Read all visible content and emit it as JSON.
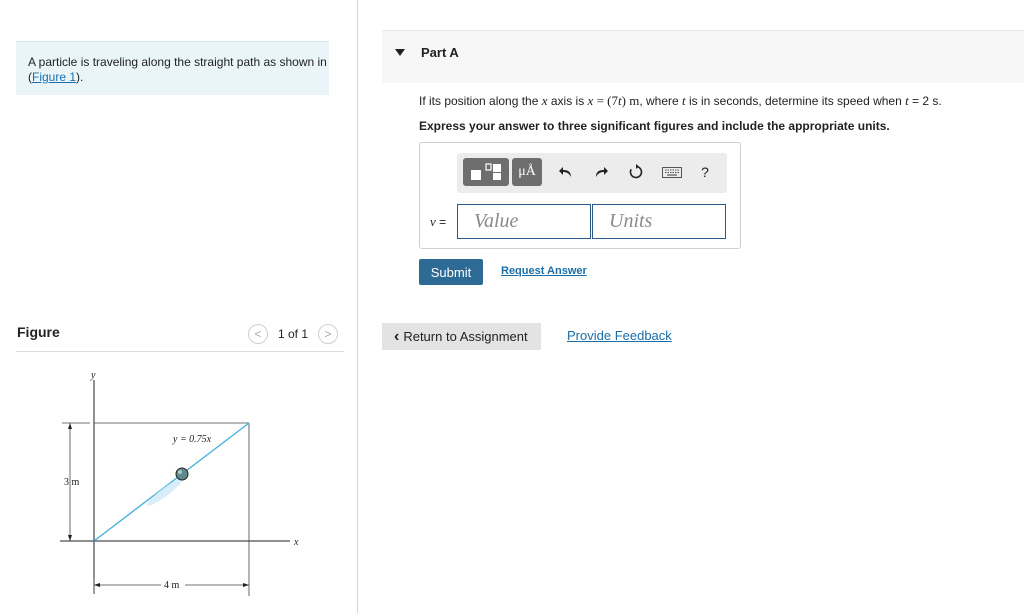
{
  "left_panel": {
    "intro_text": "A particle is traveling along the straight path as shown in",
    "intro_link_open": "(",
    "intro_link": "Figure 1",
    "intro_link_close": ").",
    "figure_heading": "Figure",
    "pager": {
      "prev": "<",
      "text": "1 of 1",
      "next": ">"
    }
  },
  "figure": {
    "axis_y": "y",
    "axis_x": "x",
    "line_equation": "y = 0.75x",
    "height_label": "3 m",
    "width_label": "4 m"
  },
  "part": {
    "title": "Part A",
    "question_a": "If its position along the ",
    "question_x1": "x",
    "question_b": " axis is ",
    "question_x2": "x",
    "question_eq": " = (7",
    "question_t1": "t",
    "question_units": ") m",
    "question_c": ", where ",
    "question_t2": "t",
    "question_d": " is in seconds, determine its speed when ",
    "question_t3": "t",
    "question_e": " = 2 s.",
    "instruction": "Express your answer to three significant figures and include the appropriate units."
  },
  "toolbar": {
    "templates_icon": "templates-icon",
    "units_button": "μÅ",
    "undo_icon": "undo-icon",
    "redo_icon": "redo-icon",
    "reset_icon": "reset-icon",
    "keyboard_icon": "keyboard-icon",
    "help": "?"
  },
  "answer": {
    "variable_label": "v",
    "equals": " =",
    "value_placeholder": "Value",
    "units_placeholder": "Units"
  },
  "actions": {
    "submit": "Submit",
    "request_answer": "Request Answer",
    "return": "Return to Assignment",
    "feedback": "Provide Feedback"
  },
  "colors": {
    "accent": "#2e6b94",
    "link": "#1a6ea8",
    "path_line": "#4ab0e0",
    "intro_bg": "#e9f5f8"
  }
}
